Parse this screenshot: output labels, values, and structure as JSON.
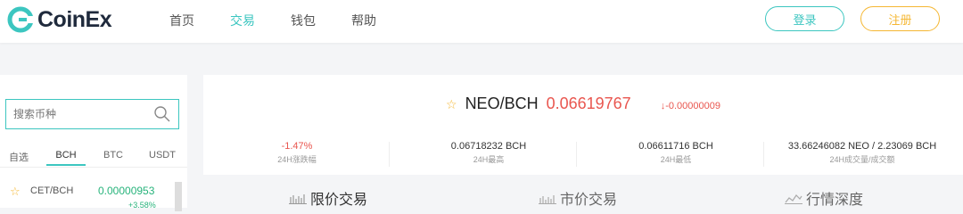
{
  "brand": {
    "name": "CoinEx",
    "color": "#3cc6c0"
  },
  "nav": {
    "items": [
      {
        "label": "首页",
        "active": false
      },
      {
        "label": "交易",
        "active": true
      },
      {
        "label": "钱包",
        "active": false
      },
      {
        "label": "帮助",
        "active": false
      }
    ],
    "login_label": "登录",
    "register_label": "注册"
  },
  "market": {
    "search_placeholder": "搜索币种",
    "tabs": [
      "自选",
      "BCH",
      "BTC",
      "USDT"
    ],
    "active_tab": "BCH",
    "rows": [
      {
        "pair": "CET/BCH",
        "price": "0.00000953",
        "change": "+3.58%"
      }
    ]
  },
  "ticker": {
    "pair": "NEO/BCH",
    "price": "0.06619767",
    "delta": "-0.00000009",
    "stats": [
      {
        "value": "-1.47%",
        "label": "24H涨跌幅"
      },
      {
        "value": "0.06718232 BCH",
        "label": "24H最高"
      },
      {
        "value": "0.06611716 BCH",
        "label": "24H最低"
      },
      {
        "value": "33.66246082 NEO / 2.23069 BCH",
        "label": "24H成交量/成交额"
      }
    ]
  },
  "trade_tabs": {
    "limit": "限价交易",
    "market": "市价交易",
    "depth": "行情深度"
  },
  "colors": {
    "up": "#27b37b",
    "down": "#e9564f",
    "accent": "#3cc6c0",
    "gold": "#f5b733"
  }
}
